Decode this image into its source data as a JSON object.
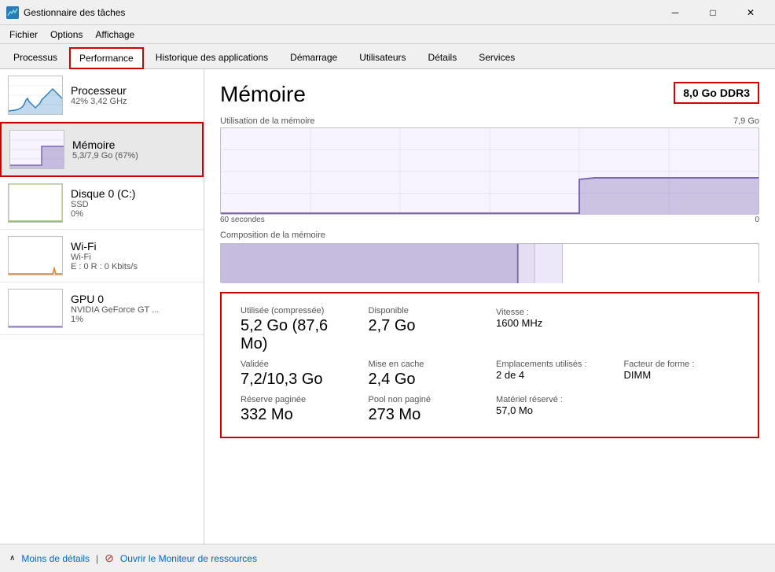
{
  "window": {
    "title": "Gestionnaire des tâches",
    "icon": "task-manager-icon"
  },
  "titlebar": {
    "minimize": "─",
    "maximize": "□",
    "close": "✕"
  },
  "menu": {
    "items": [
      "Fichier",
      "Options",
      "Affichage"
    ]
  },
  "tabs": [
    {
      "id": "processus",
      "label": "Processus",
      "active": false
    },
    {
      "id": "performance",
      "label": "Performance",
      "active": true
    },
    {
      "id": "historique",
      "label": "Historique des applications",
      "active": false
    },
    {
      "id": "demarrage",
      "label": "Démarrage",
      "active": false
    },
    {
      "id": "utilisateurs",
      "label": "Utilisateurs",
      "active": false
    },
    {
      "id": "details",
      "label": "Détails",
      "active": false
    },
    {
      "id": "services",
      "label": "Services",
      "active": false
    }
  ],
  "sidebar": {
    "items": [
      {
        "id": "processeur",
        "name": "Processeur",
        "sub1": "42% 3,42 GHz",
        "active": false,
        "type": "cpu"
      },
      {
        "id": "memoire",
        "name": "Mémoire",
        "sub1": "5,3/7,9 Go (67%)",
        "active": true,
        "type": "memory"
      },
      {
        "id": "disque",
        "name": "Disque 0 (C:)",
        "sub1": "SSD",
        "sub2": "0%",
        "active": false,
        "type": "disk"
      },
      {
        "id": "wifi",
        "name": "Wi-Fi",
        "sub1": "Wi-Fi",
        "sub2": "E : 0 R : 0 Kbits/s",
        "active": false,
        "type": "wifi"
      },
      {
        "id": "gpu",
        "name": "GPU 0",
        "sub1": "NVIDIA GeForce GT ...",
        "sub2": "1%",
        "active": false,
        "type": "gpu"
      }
    ]
  },
  "detail": {
    "title": "Mémoire",
    "badge": "8,0 Go DDR3",
    "usage_label": "Utilisation de la mémoire",
    "usage_max": "7,9 Go",
    "time_start": "60 secondes",
    "time_end": "0",
    "composition_label": "Composition de la mémoire",
    "stats": {
      "used_label": "Utilisée (compressée)",
      "used_value": "5,2 Go (87,6 Mo)",
      "available_label": "Disponible",
      "available_value": "2,7 Go",
      "speed_label": "Vitesse :",
      "speed_value": "1600 MHz",
      "validated_label": "Validée",
      "validated_value": "7,2/10,3 Go",
      "cached_label": "Mise en cache",
      "cached_value": "2,4 Go",
      "slots_label": "Emplacements utilisés :",
      "slots_value": "2 de 4",
      "form_label": "Facteur de forme :",
      "form_value": "DIMM",
      "reserved_label": "Matériel réservé :",
      "reserved_value": "57,0 Mo",
      "paged_label": "Réserve paginée",
      "paged_value": "332 Mo",
      "nonpaged_label": "Pool non paginé",
      "nonpaged_value": "273 Mo"
    }
  },
  "bottombar": {
    "toggle_label": "Moins de détails",
    "link_label": "Ouvrir le Moniteur de ressources",
    "toggle_icon": "chevron-down-icon"
  }
}
